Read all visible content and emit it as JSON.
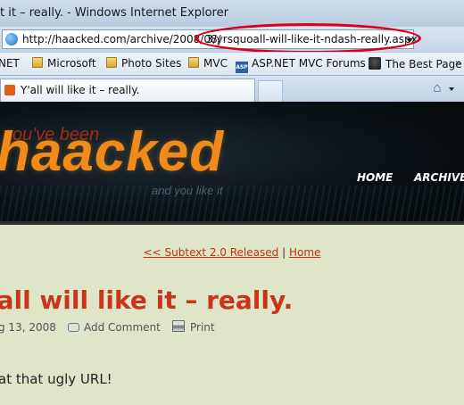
{
  "window": {
    "title": "t it – really. - Windows Internet Explorer"
  },
  "address_bar": {
    "url_prefix": "http://haacked.com/archive/2008/08/",
    "url_highlighted": "3/yrsquoall-will-like-it-ndash-really.aspx",
    "highlight_color": "#d9001b"
  },
  "favorites": [
    {
      "label": "NET",
      "icon": "none"
    },
    {
      "label": "Microsoft",
      "icon": "folder-icon"
    },
    {
      "label": "Photo Sites",
      "icon": "folder-icon"
    },
    {
      "label": "MVC",
      "icon": "folder-icon"
    },
    {
      "label": "ASP.NET MVC Forums",
      "icon": "aspnet-icon"
    },
    {
      "label": "The Best Page In",
      "icon": "che-icon"
    }
  ],
  "tab": {
    "title": "Y'all will like it – really."
  },
  "site": {
    "tagline_top": "you've been",
    "logo": "haacked",
    "tagline_bottom": "and you like it",
    "nav_home": "HOME",
    "nav_archive": "ARCHIVE",
    "brand_color": "#ef8a1b"
  },
  "post": {
    "prev_link": "<< Subtext 2.0 Released",
    "separator": "|",
    "home_link": "Home",
    "title": "'all will like it – really.",
    "date": "g 13, 2008",
    "add_comment": "Add Comment",
    "print": "Print",
    "body": "at that ugly URL!",
    "title_color": "#c9351a"
  }
}
